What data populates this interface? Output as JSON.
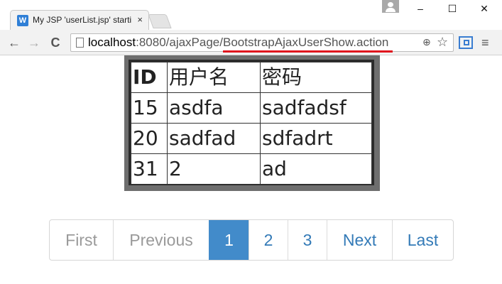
{
  "browser": {
    "tab_title": "My JSP 'userList.jsp' starting page",
    "tab_favicon": "W",
    "tab_close": "×",
    "url_host": "localhost",
    "url_rest": ":8080/ajaxPage/BootstrapAjaxUserShow.action",
    "back_glyph": "←",
    "forward_glyph": "→",
    "reload_glyph": "C",
    "zoom_glyph": "⊕",
    "star_glyph": "☆",
    "menu_glyph": "≡",
    "minimize_glyph": "–",
    "maximize_glyph": "☐",
    "close_glyph": "✕",
    "icons": [
      "favicon-icon",
      "close-icon",
      "back-icon",
      "forward-icon",
      "reload-icon",
      "page-icon",
      "zoom-icon",
      "star-icon",
      "extension-icon",
      "menu-icon",
      "profile-icon"
    ],
    "url_underline_color": "#e0141e"
  },
  "table": {
    "headers": [
      "ID",
      "用户名",
      "密码"
    ],
    "rows": [
      [
        "15",
        "asdfa",
        "sadfadsf"
      ],
      [
        "20",
        "sadfad",
        "sdfadrt"
      ],
      [
        "31",
        "2",
        "ad"
      ]
    ]
  },
  "pagination": {
    "first": "First",
    "previous": "Previous",
    "pages": [
      "1",
      "2",
      "3"
    ],
    "next": "Next",
    "last": "Last",
    "active_page": "1",
    "accent_color": "#428bca"
  }
}
